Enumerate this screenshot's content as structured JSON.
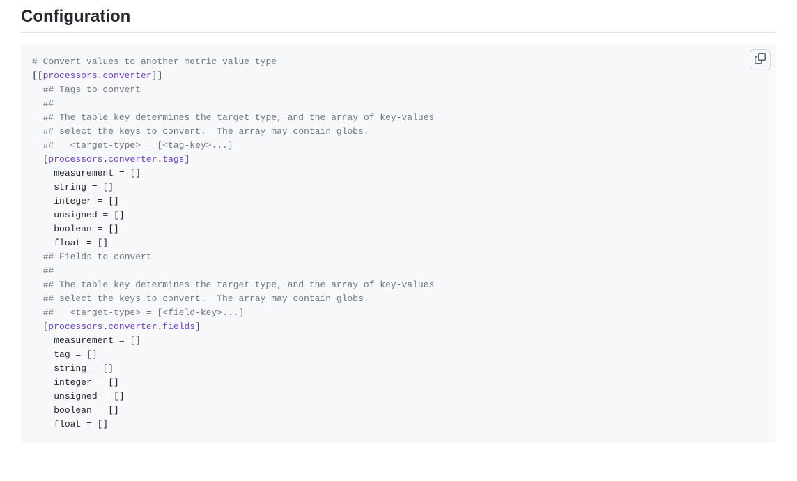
{
  "heading": "Configuration",
  "copy_tooltip": "Copy",
  "code": {
    "lines": [
      {
        "indent": 0,
        "segments": [
          {
            "t": "# Convert values to another metric value type",
            "c": "c-comment"
          }
        ]
      },
      {
        "indent": 0,
        "segments": [
          {
            "t": "[[",
            "c": "c-default"
          },
          {
            "t": "processors",
            "c": "c-hl"
          },
          {
            "t": ".",
            "c": "c-default"
          },
          {
            "t": "converter",
            "c": "c-hl"
          },
          {
            "t": "]]",
            "c": "c-default"
          }
        ]
      },
      {
        "indent": 1,
        "segments": [
          {
            "t": "## Tags to convert",
            "c": "c-comment"
          }
        ]
      },
      {
        "indent": 1,
        "segments": [
          {
            "t": "##",
            "c": "c-comment"
          }
        ]
      },
      {
        "indent": 1,
        "segments": [
          {
            "t": "## The table key determines the target type, and the array of key-values",
            "c": "c-comment"
          }
        ]
      },
      {
        "indent": 1,
        "segments": [
          {
            "t": "## select the keys to convert.  The array may contain globs.",
            "c": "c-comment"
          }
        ]
      },
      {
        "indent": 1,
        "segments": [
          {
            "t": "##   <target-type> = [<tag-key>...]",
            "c": "c-comment"
          }
        ]
      },
      {
        "indent": 1,
        "segments": [
          {
            "t": "[",
            "c": "c-default"
          },
          {
            "t": "processors",
            "c": "c-hl"
          },
          {
            "t": ".",
            "c": "c-default"
          },
          {
            "t": "converter",
            "c": "c-hl"
          },
          {
            "t": ".",
            "c": "c-default"
          },
          {
            "t": "tags",
            "c": "c-hl"
          },
          {
            "t": "]",
            "c": "c-default"
          }
        ]
      },
      {
        "indent": 2,
        "segments": [
          {
            "t": "measurement = []",
            "c": "c-default"
          }
        ]
      },
      {
        "indent": 2,
        "segments": [
          {
            "t": "string = []",
            "c": "c-default"
          }
        ]
      },
      {
        "indent": 2,
        "segments": [
          {
            "t": "integer = []",
            "c": "c-default"
          }
        ]
      },
      {
        "indent": 2,
        "segments": [
          {
            "t": "unsigned = []",
            "c": "c-default"
          }
        ]
      },
      {
        "indent": 2,
        "segments": [
          {
            "t": "boolean = []",
            "c": "c-default"
          }
        ]
      },
      {
        "indent": 2,
        "segments": [
          {
            "t": "float = []",
            "c": "c-default"
          }
        ]
      },
      {
        "indent": 0,
        "segments": [
          {
            "t": "",
            "c": "c-default"
          }
        ]
      },
      {
        "indent": 1,
        "segments": [
          {
            "t": "## Fields to convert",
            "c": "c-comment"
          }
        ]
      },
      {
        "indent": 1,
        "segments": [
          {
            "t": "##",
            "c": "c-comment"
          }
        ]
      },
      {
        "indent": 1,
        "segments": [
          {
            "t": "## The table key determines the target type, and the array of key-values",
            "c": "c-comment"
          }
        ]
      },
      {
        "indent": 1,
        "segments": [
          {
            "t": "## select the keys to convert.  The array may contain globs.",
            "c": "c-comment"
          }
        ]
      },
      {
        "indent": 1,
        "segments": [
          {
            "t": "##   <target-type> = [<field-key>...]",
            "c": "c-comment"
          }
        ]
      },
      {
        "indent": 1,
        "segments": [
          {
            "t": "[",
            "c": "c-default"
          },
          {
            "t": "processors",
            "c": "c-hl"
          },
          {
            "t": ".",
            "c": "c-default"
          },
          {
            "t": "converter",
            "c": "c-hl"
          },
          {
            "t": ".",
            "c": "c-default"
          },
          {
            "t": "fields",
            "c": "c-hl"
          },
          {
            "t": "]",
            "c": "c-default"
          }
        ]
      },
      {
        "indent": 2,
        "segments": [
          {
            "t": "measurement = []",
            "c": "c-default"
          }
        ]
      },
      {
        "indent": 2,
        "segments": [
          {
            "t": "tag = []",
            "c": "c-default"
          }
        ]
      },
      {
        "indent": 2,
        "segments": [
          {
            "t": "string = []",
            "c": "c-default"
          }
        ]
      },
      {
        "indent": 2,
        "segments": [
          {
            "t": "integer = []",
            "c": "c-default"
          }
        ]
      },
      {
        "indent": 2,
        "segments": [
          {
            "t": "unsigned = []",
            "c": "c-default"
          }
        ]
      },
      {
        "indent": 2,
        "segments": [
          {
            "t": "boolean = []",
            "c": "c-default"
          }
        ]
      },
      {
        "indent": 2,
        "segments": [
          {
            "t": "float = []",
            "c": "c-default"
          }
        ]
      }
    ]
  }
}
